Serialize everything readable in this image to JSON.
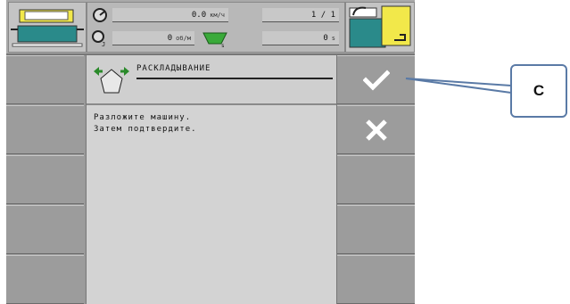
{
  "header": {
    "speed_value": "0.0",
    "speed_unit": "км/ч",
    "page_indicator": "1 / 1",
    "rpm_value": "0",
    "rpm_unit": "об/м",
    "time_value": "0",
    "time_unit": "s"
  },
  "panel": {
    "title": "РАСКЛАДЫВАНИЕ",
    "message_line1": "Разложите машину.",
    "message_line2": "Затем подтвердите."
  },
  "softkeys": {
    "confirm_icon": "checkmark-icon",
    "cancel_icon": "cross-icon"
  },
  "callout": {
    "label": "C"
  },
  "colors": {
    "background": "#9a9a9a",
    "panel": "#d3d3d3",
    "icon_teal": "#2a8a8a",
    "icon_yellow": "#f2e84a",
    "callout_border": "#5a7aa6"
  }
}
